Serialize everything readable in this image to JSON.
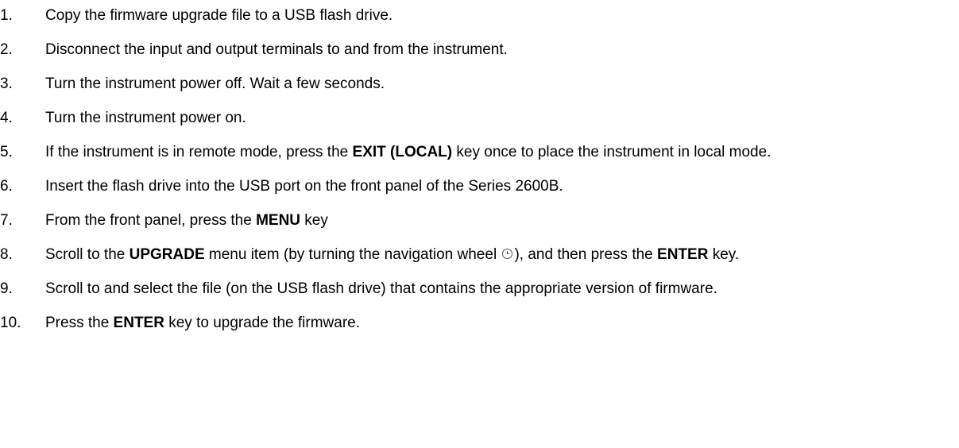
{
  "steps": [
    {
      "num": "1.",
      "parts": [
        "Copy the firmware upgrade file to a USB flash drive."
      ]
    },
    {
      "num": "2.",
      "parts": [
        "Disconnect the input and output terminals to and from the instrument."
      ]
    },
    {
      "num": "3.",
      "parts": [
        "Turn the instrument power off. Wait a few seconds."
      ]
    },
    {
      "num": "4.",
      "parts": [
        "Turn the instrument power on."
      ]
    },
    {
      "num": "5.",
      "parts": [
        "If the instrument is in remote mode, press the ",
        "EXIT (LOCAL)",
        " key once to place the instrument in local mode."
      ]
    },
    {
      "num": "6.",
      "parts": [
        "Insert the flash drive into the USB port on the front panel of the Series 2600B."
      ]
    },
    {
      "num": "7.",
      "parts": [
        "From the front panel, press the ",
        "MENU",
        " key"
      ]
    },
    {
      "num": "8.",
      "parts": [
        "Scroll to the ",
        "UPGRADE",
        " menu item (by turning the navigation wheel ",
        "), and then press the ",
        "ENTER",
        " key."
      ]
    },
    {
      "num": "9.",
      "parts": [
        "Scroll to and select the file (on the USB flash drive) that contains the appropriate version of firmware."
      ]
    },
    {
      "num": "10.",
      "parts": [
        "Press the ",
        "ENTER",
        " key to upgrade the firmware."
      ]
    }
  ],
  "icons": {
    "navigation_wheel": "navigation-wheel-icon"
  }
}
